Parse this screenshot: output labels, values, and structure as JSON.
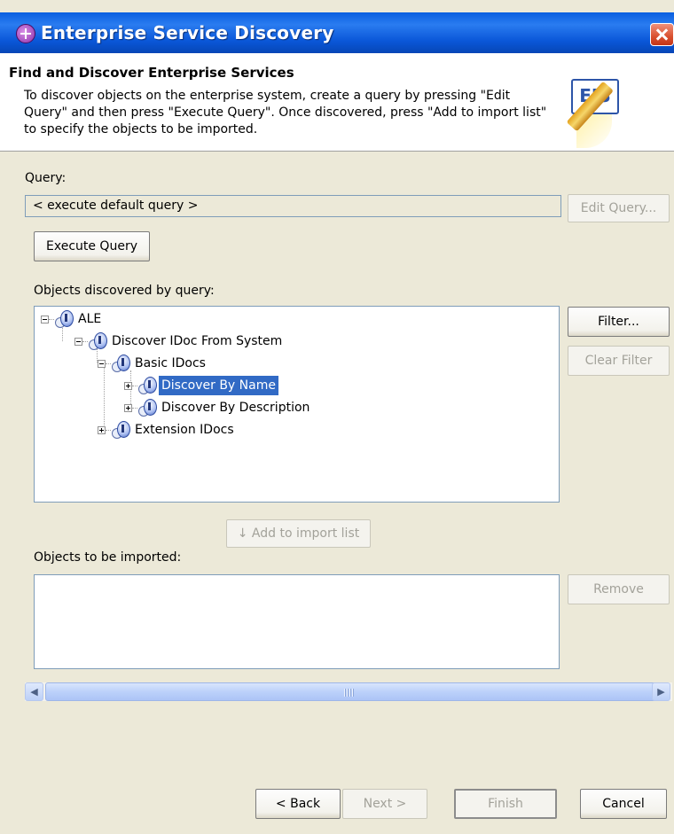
{
  "window": {
    "title": "Enterprise Service Discovery"
  },
  "header": {
    "title": "Find and Discover Enterprise Services",
    "description": "To discover objects on the enterprise system, create a query by pressing \"Edit Query\" and then press \"Execute Query\". Once discovered, press \"Add to import list\" to specify the objects to be imported.",
    "logo_text": "EIS"
  },
  "query": {
    "label": "Query:",
    "value": "< execute default query >",
    "edit_button": "Edit Query...",
    "execute_button": "Execute Query"
  },
  "discovered": {
    "label": "Objects discovered by query:",
    "filter_button": "Filter...",
    "clear_filter_button": "Clear Filter",
    "tree": [
      {
        "label": "ALE",
        "expanded": true
      },
      {
        "label": "Discover IDoc From System",
        "expanded": true
      },
      {
        "label": "Basic IDocs",
        "expanded": true
      },
      {
        "label": "Discover By Name",
        "expanded": false,
        "selected": true
      },
      {
        "label": "Discover By Description",
        "expanded": false
      },
      {
        "label": "Extension IDocs",
        "expanded": false
      }
    ]
  },
  "import": {
    "add_button": "↓ Add to import list",
    "label": "Objects to be imported:",
    "remove_button": "Remove"
  },
  "footer": {
    "back_button": "< Back",
    "next_button": "Next >",
    "finish_button": "Finish",
    "cancel_button": "Cancel"
  },
  "colors": {
    "title_bar": "#0a5fe0",
    "selection": "#316ac5",
    "dialog_bg": "#ece9d8"
  }
}
